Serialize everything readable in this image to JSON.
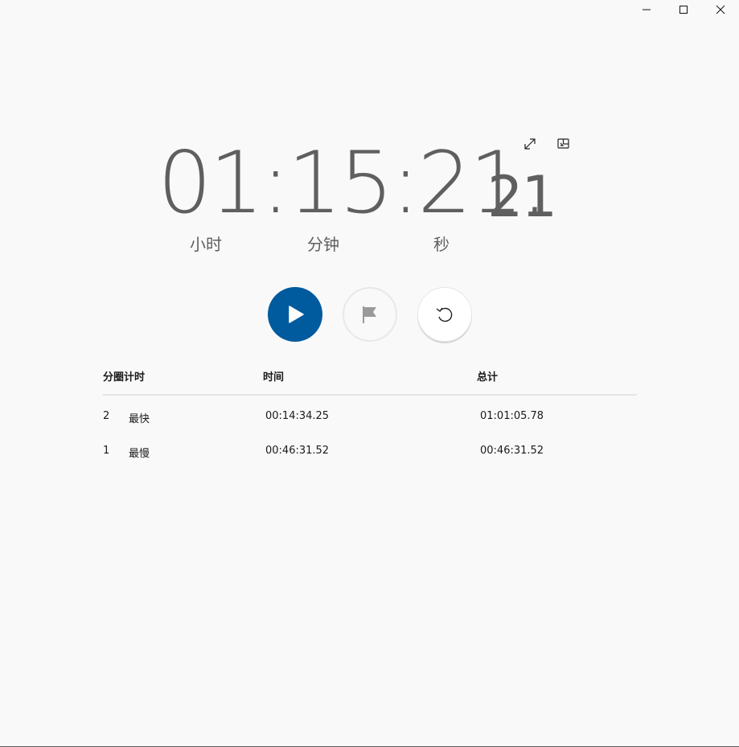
{
  "window": {
    "controls": [
      "minimize",
      "maximize",
      "close"
    ]
  },
  "toolbar": {
    "expand_icon": "expand-icon",
    "keep_on_top_icon": "compact-overlay-icon"
  },
  "timer": {
    "main": "01:15:21.",
    "fraction": "21",
    "units": {
      "hours": "小时",
      "minutes": "分钟",
      "seconds": "秒"
    }
  },
  "buttons": {
    "play_icon": "play-icon",
    "lap_icon": "flag-icon",
    "reset_icon": "reset-icon",
    "play_color": "#005a9e"
  },
  "laps": {
    "headers": {
      "lap": "分圈计时",
      "time": "时间",
      "total": "总计"
    },
    "rows": [
      {
        "num": "2",
        "tag": "最快",
        "time": "00:14:34.25",
        "total": "01:01:05.78"
      },
      {
        "num": "1",
        "tag": "最慢",
        "time": "00:46:31.52",
        "total": "00:46:31.52"
      }
    ]
  }
}
